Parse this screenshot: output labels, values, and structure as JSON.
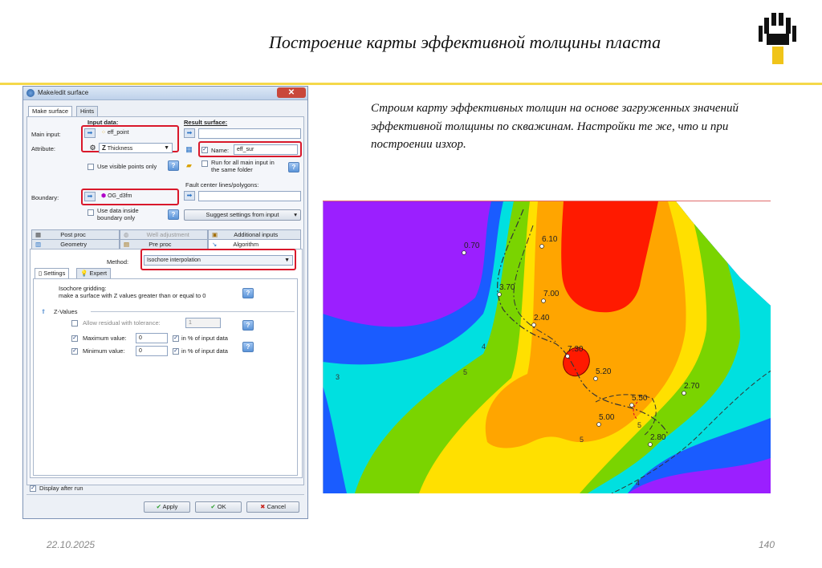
{
  "slide": {
    "title": "Построение карты эффективной толщины пласта",
    "description": "Строим карту эффективных толщин на основе загруженных значений эффективной толщины по скважинам. Настройки те же, что и при построении изхор.",
    "date": "22.10.2025",
    "page": "140"
  },
  "dialog": {
    "title": "Make/edit surface",
    "close_glyph": "✕",
    "tabs_top": [
      "Make surface",
      "Hints"
    ],
    "input_header": "Input data:",
    "result_header": "Result surface:",
    "main_input_label": "Main input:",
    "main_input_value": "eff_point",
    "attribute_label": "Attribute:",
    "attribute_value": "Thickness",
    "use_visible_points": "Use visible points only",
    "name_label": "Name:",
    "name_value": "eff_sur",
    "run_all": "Run for all main input in the same folder",
    "fault_label": "Fault center lines/polygons:",
    "boundary_label": "Boundary:",
    "boundary_value": "OG_d3fm",
    "use_data_inside": "Use data inside boundary only",
    "suggest_button": "Suggest settings from input",
    "tabs_row1": [
      "Post proc",
      "Well adjustment",
      "Additional inputs"
    ],
    "tabs_row2": [
      "Geometry",
      "Pre proc",
      "Algorithm"
    ],
    "method_label": "Method:",
    "method_value": "Isochore interpolation",
    "subtabs": [
      "Settings",
      "Expert"
    ],
    "isochore_title": "Isochore gridding:",
    "isochore_desc": "make a surface with Z values greater than or equal to 0",
    "zvalues_label": "Z-Values",
    "allow_residual": "Allow residual with tolerance:",
    "allow_residual_value": "1",
    "max_label": "Maximum value:",
    "max_value": "0",
    "min_label": "Minimum value:",
    "min_value": "0",
    "pct_label": "in % of input data",
    "display_after_run": "Display after run",
    "apply_label": "Apply",
    "ok_label": "OK",
    "cancel_label": "Cancel"
  },
  "map": {
    "well_labels": [
      "0.70",
      "6.10",
      "3.70",
      "7.00",
      "2.40",
      "7.30",
      "5.20",
      "2.70",
      "5.50",
      "5.00",
      "2.80"
    ],
    "contour_labels": [
      "4",
      "5",
      "3",
      "5",
      "4",
      "5"
    ]
  },
  "colors": {
    "accent_yellow": "#f5d84a",
    "highlight_red": "#d9182b",
    "map_red": "#ff1a00",
    "map_orange": "#ffa500",
    "map_yellow": "#ffe000",
    "map_green": "#7ad400",
    "map_cyan": "#00e0e0",
    "map_blue": "#1a5cff",
    "map_purple": "#9b1fff"
  }
}
